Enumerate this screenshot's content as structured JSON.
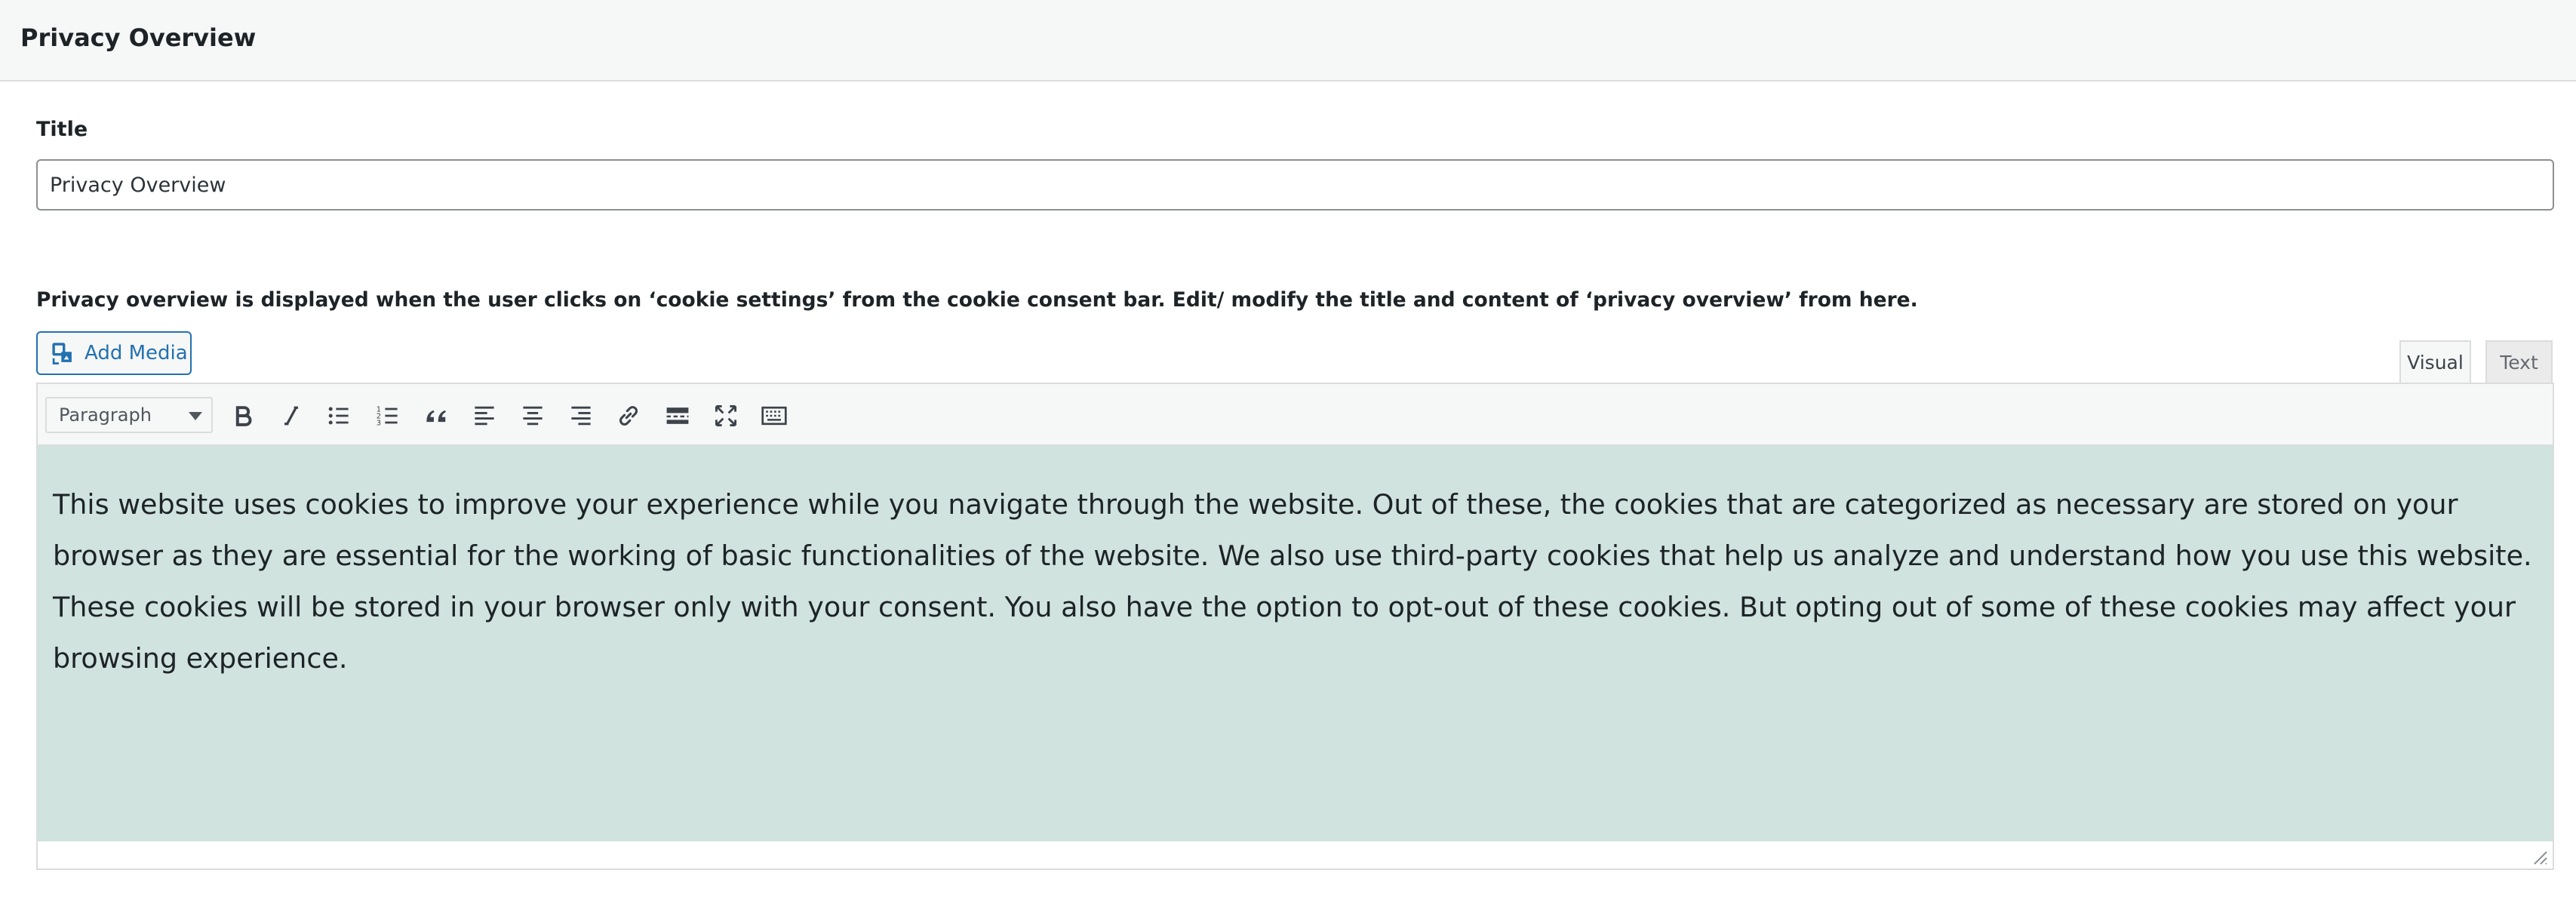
{
  "header": {
    "title": "Privacy Overview"
  },
  "title_field": {
    "label": "Title",
    "value": "Privacy Overview"
  },
  "description": "Privacy overview is displayed when the user clicks on ‘cookie settings’ from the cookie consent bar. Edit/ modify the title and content of ‘privacy overview’ from here.",
  "media": {
    "add_label": "Add Media"
  },
  "editor": {
    "tabs": {
      "visual": "Visual",
      "text": "Text"
    },
    "active_tab": "Visual",
    "format": "Paragraph",
    "toolbar_icons": [
      "bold-icon",
      "italic-icon",
      "bullet-list-icon",
      "numbered-list-icon",
      "blockquote-icon",
      "align-left-icon",
      "align-center-icon",
      "align-right-icon",
      "link-icon",
      "read-more-icon",
      "fullscreen-icon",
      "keyboard-toolbar-icon"
    ],
    "content": "This website uses cookies to improve your experience while you navigate through the website. Out of these, the cookies that are categorized as necessary are stored on your browser as they are essential for the working of basic functionalities of the website. We also use third-party cookies that help us analyze and understand how you use this website. These cookies will be stored in your browser only with your consent. You also have the option to opt-out of these cookies. But opting out of some of these cookies may affect your browsing experience."
  },
  "colors": {
    "accent": "#2271b1",
    "content_bg": "#d0e3de",
    "header_bg": "#f6f7f7"
  }
}
